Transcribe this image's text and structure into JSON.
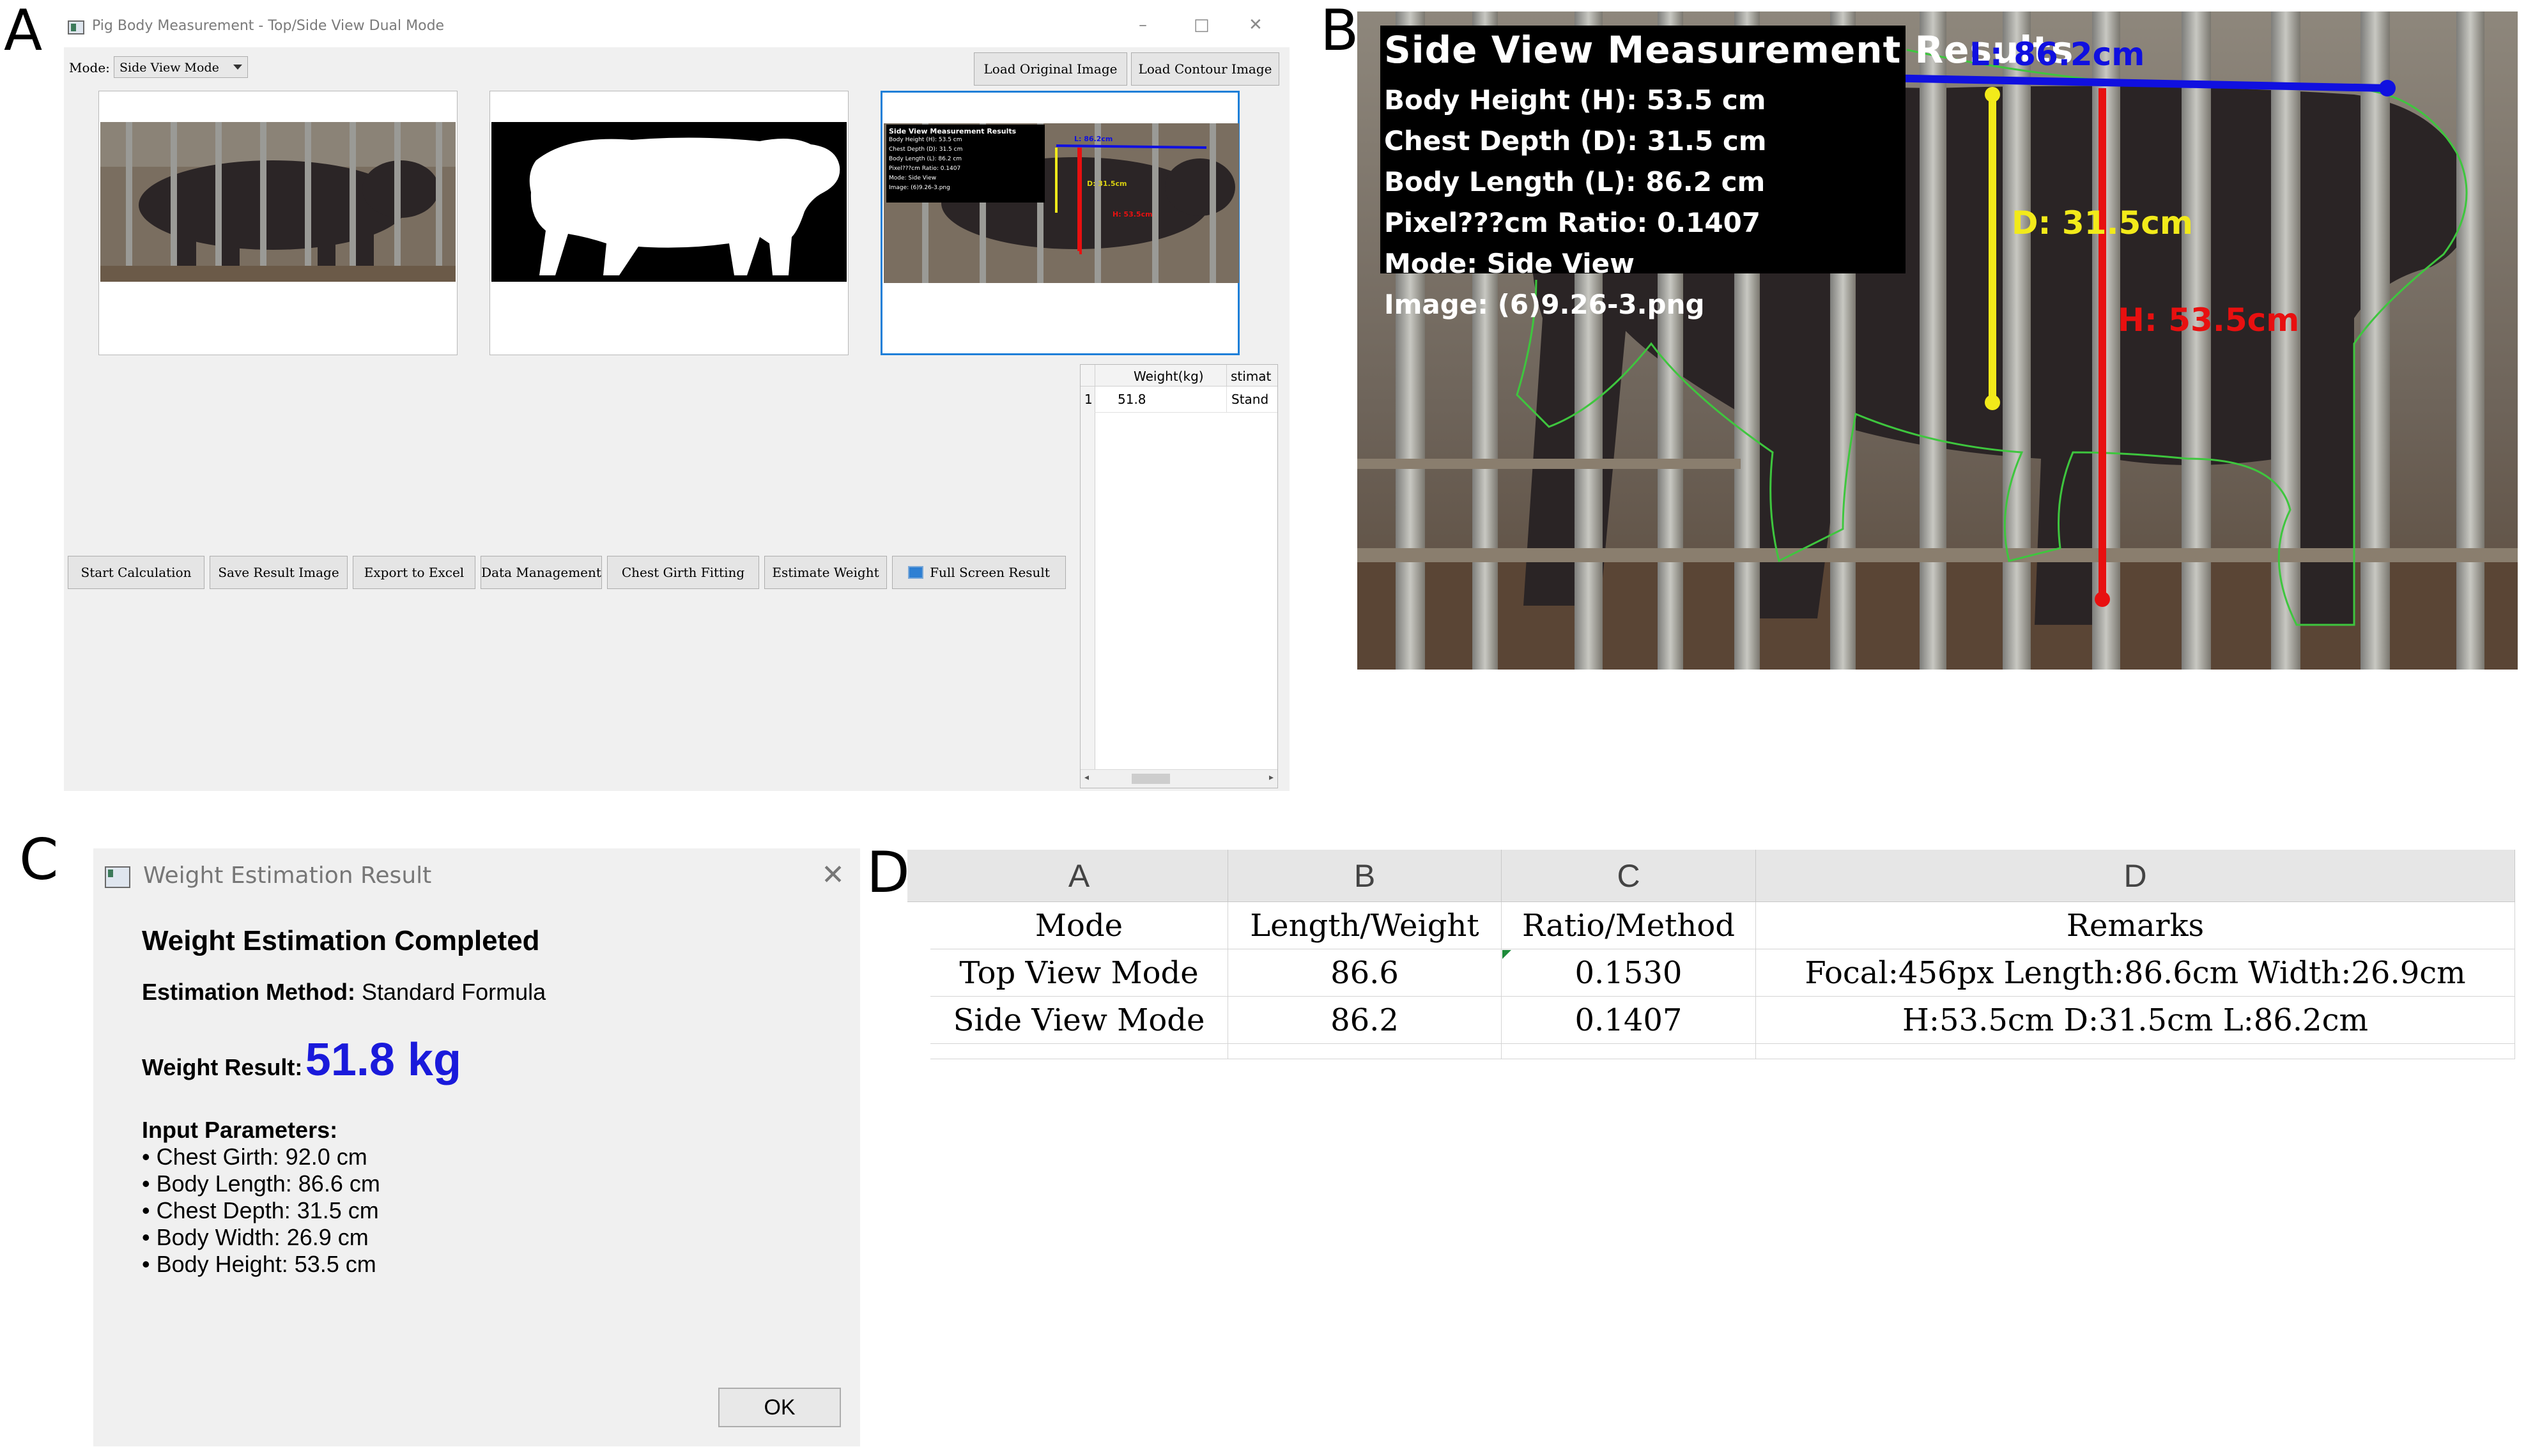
{
  "panel_labels": {
    "a": "A",
    "b": "B",
    "c": "C",
    "d": "D"
  },
  "window_a": {
    "title": "Pig Body Measurement - Top/Side View Dual Mode",
    "controls": {
      "minimize": "–",
      "maximize": "□",
      "close": "✕"
    },
    "mode_label": "Mode:",
    "mode_value": "Side View Mode",
    "load_original": "Load Original Image",
    "load_contour": "Load Contour Image",
    "preview_overlay": {
      "title": "Side View Measurement Results",
      "lines": [
        "Body Height (H): 53.5 cm",
        "Chest Depth (D): 31.5 cm",
        "Body Length (L): 86.2 cm",
        "Pixel???cm Ratio: 0.1407",
        "Mode: Side View",
        "Image: (6)9.26-3.png"
      ],
      "l_tag": "L: 86.2cm",
      "d_tag": "D: 31.5cm",
      "h_tag": "H: 53.5cm"
    },
    "buttons": [
      "Start Calculation",
      "Save Result Image",
      "Export to Excel",
      "Data Management",
      "Chest Girth Fitting",
      "Estimate Weight",
      "Full Screen Result"
    ],
    "table": {
      "headers": [
        "Weight(kg)",
        "stimat"
      ],
      "rows": [
        {
          "index": "1",
          "weight": "51.8",
          "method": "Stand"
        }
      ]
    }
  },
  "panel_b": {
    "title": "Side View Measurement Results",
    "lines": [
      "Body Height (H): 53.5 cm",
      "Chest Depth (D): 31.5 cm",
      "Body Length (L): 86.2 cm",
      "Pixel???cm Ratio: 0.1407",
      "Mode: Side View",
      "Image: (6)9.26-3.png"
    ],
    "l_tag": "L: 86.2cm",
    "d_tag": "D: 31.5cm",
    "h_tag": "H: 53.5cm",
    "colors": {
      "length": "#1010e0",
      "depth": "#f2ea1a",
      "height": "#e81010",
      "contour": "#3ec63e"
    }
  },
  "dialog_c": {
    "title": "Weight Estimation Result",
    "close": "✕",
    "heading": "Weight Estimation Completed",
    "method_label": "Estimation Method:",
    "method_value": "Standard Formula",
    "result_label": "Weight Result:",
    "result_value": "51.8 kg",
    "params_label": "Input Parameters:",
    "params": [
      "• Chest Girth: 92.0 cm",
      "• Body Length: 86.6 cm",
      "• Chest Depth: 31.5 cm",
      "• Body Width: 26.9 cm",
      "• Body Height: 53.5 cm"
    ],
    "ok": "OK",
    "result_color": "#1a1adb"
  },
  "sheet_d": {
    "columns": [
      "A",
      "B",
      "C",
      "D"
    ],
    "header_row": [
      "Mode",
      "Length/Weight",
      "Ratio/Method",
      "Remarks"
    ],
    "rows": [
      [
        "Top View Mode",
        "86.6",
        "0.1530",
        "Focal:456px Length:86.6cm Width:26.9cm"
      ],
      [
        "Side View Mode",
        "86.2",
        "0.1407",
        "H:53.5cm D:31.5cm L:86.2cm"
      ]
    ]
  }
}
